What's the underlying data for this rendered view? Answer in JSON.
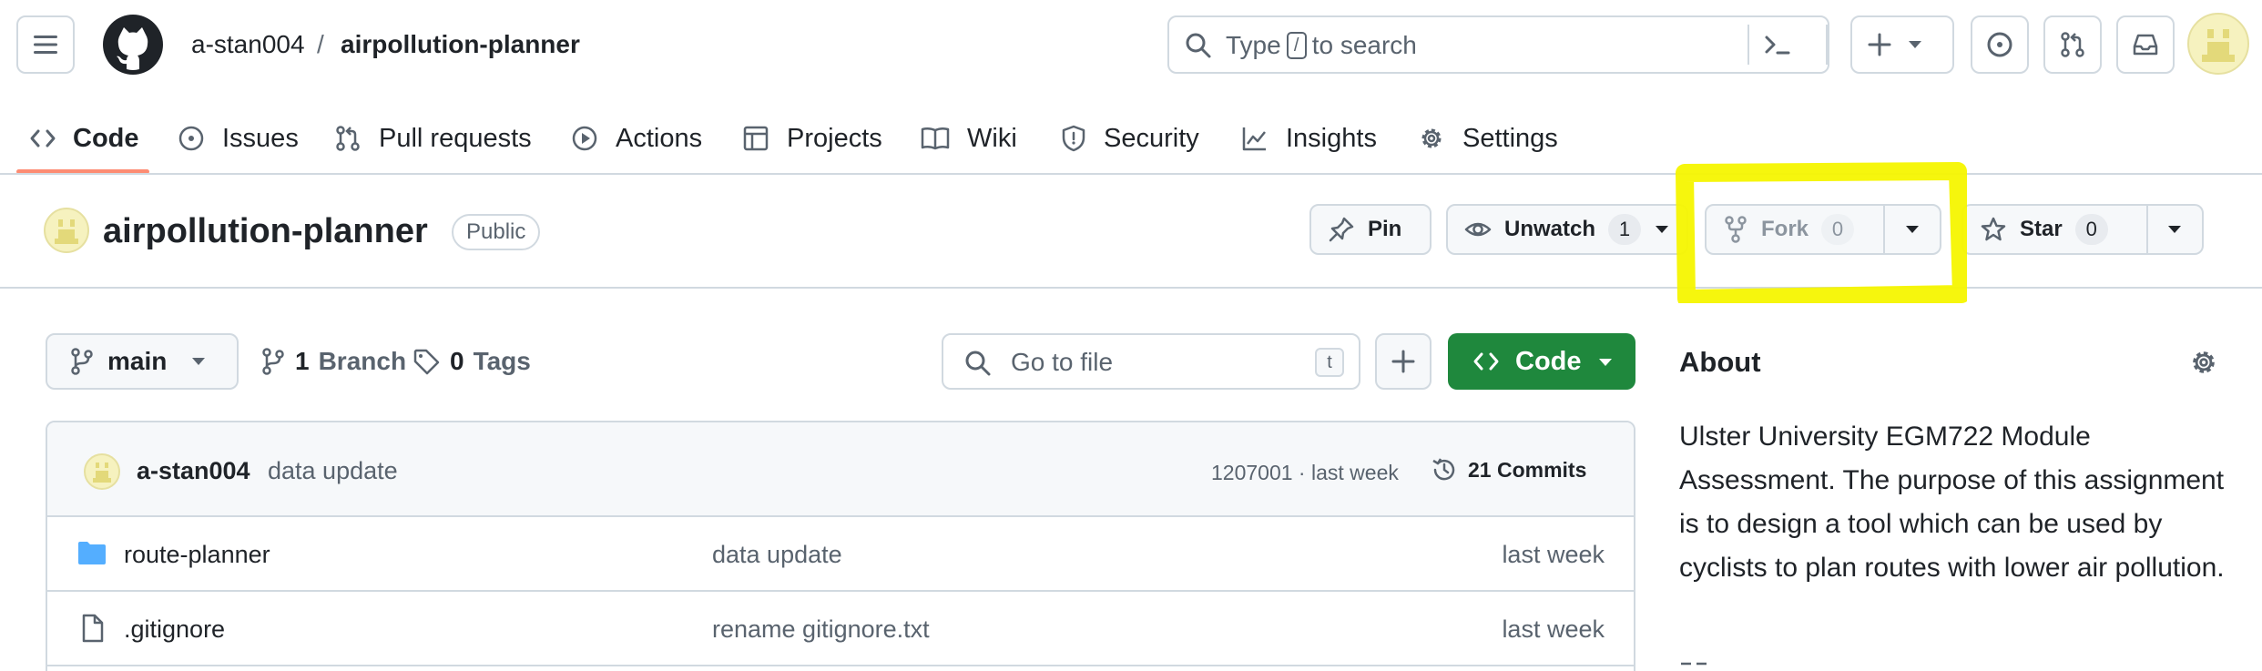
{
  "header": {
    "owner": "a-stan004",
    "separator": "/",
    "repo": "airpollution-planner",
    "search": {
      "prefix": "Type",
      "key": "/",
      "suffix": "to search"
    }
  },
  "nav": {
    "tabs": [
      {
        "label": "Code",
        "icon": "code-icon",
        "active": true
      },
      {
        "label": "Issues",
        "icon": "issue-opened-icon"
      },
      {
        "label": "Pull requests",
        "icon": "git-pull-request-icon"
      },
      {
        "label": "Actions",
        "icon": "play-icon"
      },
      {
        "label": "Projects",
        "icon": "table-icon"
      },
      {
        "label": "Wiki",
        "icon": "book-icon"
      },
      {
        "label": "Security",
        "icon": "shield-icon"
      },
      {
        "label": "Insights",
        "icon": "graph-icon"
      },
      {
        "label": "Settings",
        "icon": "gear-icon"
      }
    ]
  },
  "repo": {
    "name": "airpollution-planner",
    "visibility": "Public",
    "pin_label": "Pin",
    "watch_label": "Unwatch",
    "watch_count": "1",
    "fork_label": "Fork",
    "fork_count": "0",
    "star_label": "Star",
    "star_count": "0"
  },
  "branch": {
    "current": "main",
    "branch_count": "1",
    "branch_label": "Branch",
    "tag_count": "0",
    "tag_label": "Tags",
    "goto_placeholder": "Go to file",
    "goto_key": "t",
    "code_label": "Code"
  },
  "latest_commit": {
    "author": "a-stan004",
    "message": "data update",
    "sha_time": "1207001 · last week",
    "commits_label": "21 Commits"
  },
  "files": [
    {
      "name": "route-planner",
      "type": "folder",
      "message": "data update",
      "time": "last week"
    },
    {
      "name": ".gitignore",
      "type": "file",
      "message": "rename gitignore.txt",
      "time": "last week"
    }
  ],
  "about": {
    "title": "About",
    "description": "Ulster University EGM722 Module Assessment. The purpose of this assignment is to design a tool which can be used by cyclists to plan routes with lower air pollution."
  },
  "colors": {
    "accent_green": "#1f883d",
    "nav_underline": "#fd8c73",
    "highlight": "#f5f500",
    "folder": "#54aeff"
  }
}
